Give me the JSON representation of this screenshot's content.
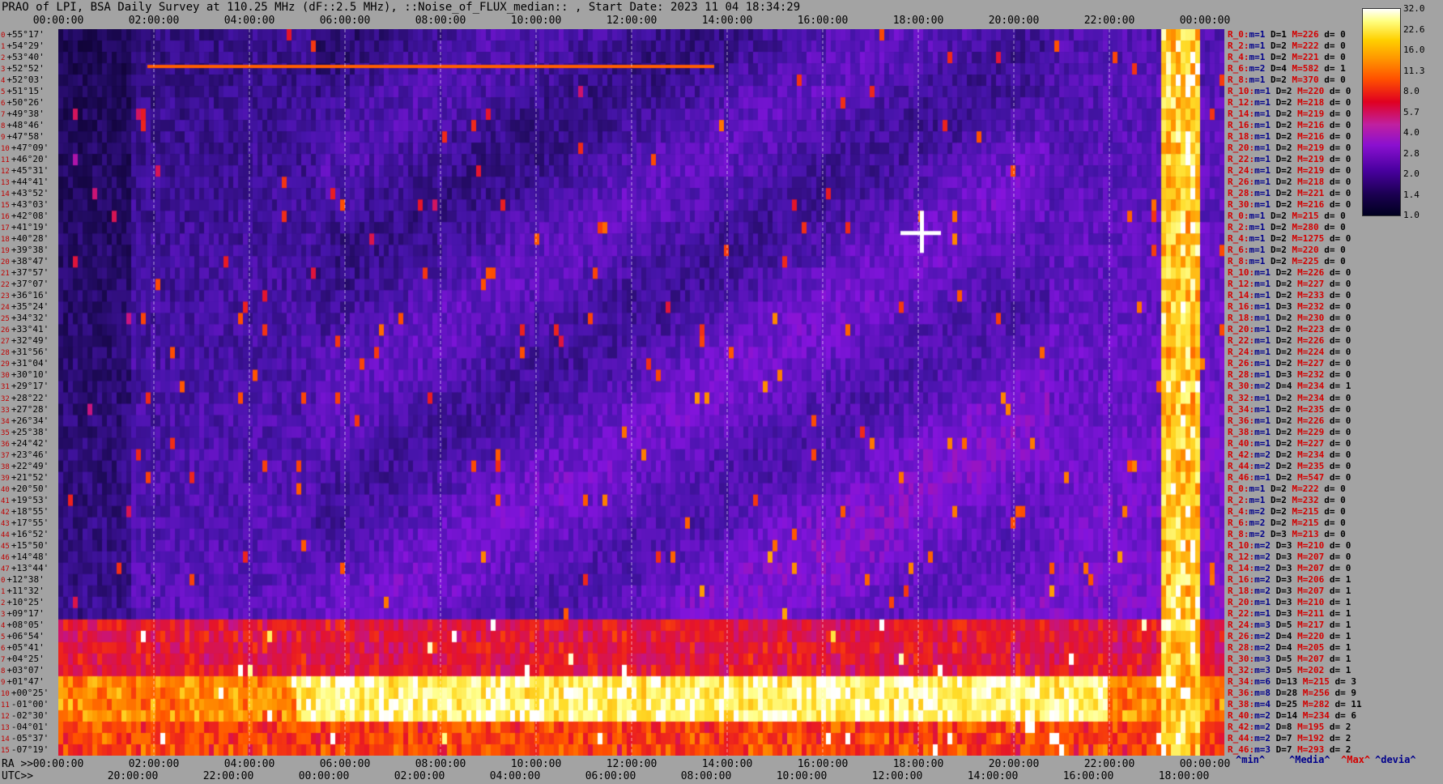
{
  "title": "PRAO of LPI, BSA Daily Survey at 110.25 MHz (dF::2.5 MHz), ::Noise_of_FLUX_median:: , Start Date: 2023 11 04 18:34:29",
  "colors": {
    "background": "#a3a3a3",
    "stat_red": "#d40000",
    "stat_blue": "#00008b"
  },
  "axes": {
    "top_ticks": [
      "00:00:00",
      "02:00:00",
      "04:00:00",
      "06:00:00",
      "08:00:00",
      "10:00:00",
      "12:00:00",
      "14:00:00",
      "16:00:00",
      "18:00:00",
      "20:00:00",
      "22:00:00",
      "00:00:00"
    ],
    "ra_prefix": "RA >>",
    "ra_ticks": [
      "00:00:00",
      "02:00:00",
      "04:00:00",
      "06:00:00",
      "08:00:00",
      "10:00:00",
      "12:00:00",
      "14:00:00",
      "16:00:00",
      "18:00:00",
      "20:00:00",
      "22:00:00",
      "00:00:00"
    ],
    "utc_prefix": "UTC>>",
    "utc_ticks": [
      "20:00:00",
      "22:00:00",
      "00:00:00",
      "02:00:00",
      "04:00:00",
      "06:00:00",
      "08:00:00",
      "10:00:00",
      "12:00:00",
      "14:00:00",
      "16:00:00",
      "18:00:00"
    ]
  },
  "colorbar": {
    "ticks": [
      "32.0",
      "22.6",
      "16.0",
      "11.3",
      "8.0",
      "5.7",
      "4.0",
      "2.8",
      "2.0",
      "1.4",
      "1.0"
    ]
  },
  "legend": [
    "^min^",
    "^Media^",
    "^Max^",
    "^devia^"
  ],
  "dec_labels": [
    "+55°17'",
    "+54°29'",
    "+53°40'",
    "+52°52'",
    "+52°03'",
    "+51°15'",
    "+50°26'",
    "+49°38'",
    "+48°46'",
    "+47°58'",
    "+47°09'",
    "+46°20'",
    "+45°31'",
    "+44°41'",
    "+43°52'",
    "+43°03'",
    "+42°08'",
    "+41°19'",
    "+40°28'",
    "+39°38'",
    "+38°47'",
    "+37°57'",
    "+37°07'",
    "+36°16'",
    "+35°24'",
    "+34°32'",
    "+33°41'",
    "+32°49'",
    "+31°56'",
    "+31°04'",
    "+30°10'",
    "+29°17'",
    "+28°22'",
    "+27°28'",
    "+26°34'",
    "+25°38'",
    "+24°42'",
    "+23°46'",
    "+22°49'",
    "+21°52'",
    "+20°50'",
    "+19°53'",
    "+18°55'",
    "+17°55'",
    "+16°52'",
    "+15°50'",
    "+14°48'",
    "+13°44'",
    "+12°38'",
    "+11°32'",
    "+10°25'",
    "+09°17'",
    "+08°05'",
    "+06°54'",
    "+05°41'",
    "+04°25'",
    "+03°07'",
    "+01°47'",
    "+00°25'",
    "-01°00'",
    "-02°30'",
    "-04°01'",
    "-05°37'",
    "-07°19'"
  ],
  "row_stats": [
    {
      "r": "R_0:",
      "m": "1",
      "D": "1",
      "M": "226",
      "d": "0"
    },
    {
      "r": "R_2:",
      "m": "1",
      "D": "2",
      "M": "222",
      "d": "0"
    },
    {
      "r": "R_4:",
      "m": "1",
      "D": "2",
      "M": "221",
      "d": "0"
    },
    {
      "r": "R_6:",
      "m": "2",
      "D": "4",
      "M": "582",
      "d": "1"
    },
    {
      "r": "R_8:",
      "m": "1",
      "D": "2",
      "M": "370",
      "d": "0"
    },
    {
      "r": "R_10:",
      "m": "1",
      "D": "2",
      "M": "220",
      "d": "0"
    },
    {
      "r": "R_12:",
      "m": "1",
      "D": "2",
      "M": "218",
      "d": "0"
    },
    {
      "r": "R_14:",
      "m": "1",
      "D": "2",
      "M": "219",
      "d": "0"
    },
    {
      "r": "R_16:",
      "m": "1",
      "D": "2",
      "M": "216",
      "d": "0"
    },
    {
      "r": "R_18:",
      "m": "1",
      "D": "2",
      "M": "216",
      "d": "0"
    },
    {
      "r": "R_20:",
      "m": "1",
      "D": "2",
      "M": "219",
      "d": "0"
    },
    {
      "r": "R_22:",
      "m": "1",
      "D": "2",
      "M": "219",
      "d": "0"
    },
    {
      "r": "R_24:",
      "m": "1",
      "D": "2",
      "M": "219",
      "d": "0"
    },
    {
      "r": "R_26:",
      "m": "1",
      "D": "2",
      "M": "218",
      "d": "0"
    },
    {
      "r": "R_28:",
      "m": "1",
      "D": "2",
      "M": "221",
      "d": "0"
    },
    {
      "r": "R_30:",
      "m": "1",
      "D": "2",
      "M": "216",
      "d": "0"
    },
    {
      "r": "R_0:",
      "m": "1",
      "D": "2",
      "M": "215",
      "d": "0"
    },
    {
      "r": "R_2:",
      "m": "1",
      "D": "2",
      "M": "280",
      "d": "0"
    },
    {
      "r": "R_4:",
      "m": "1",
      "D": "2",
      "M": "1275",
      "d": "0"
    },
    {
      "r": "R_6:",
      "m": "1",
      "D": "2",
      "M": "220",
      "d": "0"
    },
    {
      "r": "R_8:",
      "m": "1",
      "D": "2",
      "M": "225",
      "d": "0"
    },
    {
      "r": "R_10:",
      "m": "1",
      "D": "2",
      "M": "226",
      "d": "0"
    },
    {
      "r": "R_12:",
      "m": "1",
      "D": "2",
      "M": "227",
      "d": "0"
    },
    {
      "r": "R_14:",
      "m": "1",
      "D": "2",
      "M": "233",
      "d": "0"
    },
    {
      "r": "R_16:",
      "m": "1",
      "D": "3",
      "M": "232",
      "d": "0"
    },
    {
      "r": "R_18:",
      "m": "1",
      "D": "2",
      "M": "230",
      "d": "0"
    },
    {
      "r": "R_20:",
      "m": "1",
      "D": "2",
      "M": "223",
      "d": "0"
    },
    {
      "r": "R_22:",
      "m": "1",
      "D": "2",
      "M": "226",
      "d": "0"
    },
    {
      "r": "R_24:",
      "m": "1",
      "D": "2",
      "M": "224",
      "d": "0"
    },
    {
      "r": "R_26:",
      "m": "1",
      "D": "2",
      "M": "227",
      "d": "0"
    },
    {
      "r": "R_28:",
      "m": "1",
      "D": "3",
      "M": "232",
      "d": "0"
    },
    {
      "r": "R_30:",
      "m": "2",
      "D": "4",
      "M": "234",
      "d": "1"
    },
    {
      "r": "R_32:",
      "m": "1",
      "D": "2",
      "M": "234",
      "d": "0"
    },
    {
      "r": "R_34:",
      "m": "1",
      "D": "2",
      "M": "235",
      "d": "0"
    },
    {
      "r": "R_36:",
      "m": "1",
      "D": "2",
      "M": "226",
      "d": "0"
    },
    {
      "r": "R_38:",
      "m": "1",
      "D": "2",
      "M": "229",
      "d": "0"
    },
    {
      "r": "R_40:",
      "m": "1",
      "D": "2",
      "M": "227",
      "d": "0"
    },
    {
      "r": "R_42:",
      "m": "2",
      "D": "2",
      "M": "234",
      "d": "0"
    },
    {
      "r": "R_44:",
      "m": "2",
      "D": "2",
      "M": "235",
      "d": "0"
    },
    {
      "r": "R_46:",
      "m": "1",
      "D": "2",
      "M": "547",
      "d": "0"
    },
    {
      "r": "R_0:",
      "m": "1",
      "D": "2",
      "M": "222",
      "d": "0"
    },
    {
      "r": "R_2:",
      "m": "1",
      "D": "2",
      "M": "232",
      "d": "0"
    },
    {
      "r": "R_4:",
      "m": "2",
      "D": "2",
      "M": "215",
      "d": "0"
    },
    {
      "r": "R_6:",
      "m": "2",
      "D": "2",
      "M": "215",
      "d": "0"
    },
    {
      "r": "R_8:",
      "m": "2",
      "D": "3",
      "M": "213",
      "d": "0"
    },
    {
      "r": "R_10:",
      "m": "2",
      "D": "3",
      "M": "210",
      "d": "0"
    },
    {
      "r": "R_12:",
      "m": "2",
      "D": "3",
      "M": "207",
      "d": "0"
    },
    {
      "r": "R_14:",
      "m": "2",
      "D": "3",
      "M": "207",
      "d": "0"
    },
    {
      "r": "R_16:",
      "m": "2",
      "D": "3",
      "M": "206",
      "d": "1"
    },
    {
      "r": "R_18:",
      "m": "2",
      "D": "3",
      "M": "207",
      "d": "1"
    },
    {
      "r": "R_20:",
      "m": "1",
      "D": "3",
      "M": "210",
      "d": "1"
    },
    {
      "r": "R_22:",
      "m": "1",
      "D": "3",
      "M": "211",
      "d": "1"
    },
    {
      "r": "R_24:",
      "m": "3",
      "D": "5",
      "M": "217",
      "d": "1"
    },
    {
      "r": "R_26:",
      "m": "2",
      "D": "4",
      "M": "220",
      "d": "1"
    },
    {
      "r": "R_28:",
      "m": "2",
      "D": "4",
      "M": "205",
      "d": "1"
    },
    {
      "r": "R_30:",
      "m": "3",
      "D": "5",
      "M": "207",
      "d": "1"
    },
    {
      "r": "R_32:",
      "m": "3",
      "D": "5",
      "M": "202",
      "d": "1"
    },
    {
      "r": "R_34:",
      "m": "6",
      "D": "13",
      "M": "215",
      "d": "3"
    },
    {
      "r": "R_36:",
      "m": "8",
      "D": "28",
      "M": "256",
      "d": "9"
    },
    {
      "r": "R_38:",
      "m": "4",
      "D": "25",
      "M": "282",
      "d": "11"
    },
    {
      "r": "R_40:",
      "m": "2",
      "D": "14",
      "M": "234",
      "d": "6"
    },
    {
      "r": "R_42:",
      "m": "2",
      "D": "8",
      "M": "195",
      "d": "2"
    },
    {
      "r": "R_44:",
      "m": "2",
      "D": "7",
      "M": "192",
      "d": "2"
    },
    {
      "r": "R_46:",
      "m": "3",
      "D": "7",
      "M": "293",
      "d": "2"
    }
  ],
  "chart_data": {
    "type": "heatmap",
    "title": "PRAO of LPI, BSA Daily Survey at 110.25 MHz (dF::2.5 MHz), ::Noise_of_FLUX_median:: , Start Date: 2023 11 04 18:34:29",
    "x_axis": "RA 00:00:00 to 24:00:00",
    "y_axis": "Declination +55°17' to -07°19'",
    "colorscale_range": [
      1.0,
      32.0
    ],
    "rows": 64,
    "bright_band_rows": [
      57,
      58,
      59,
      60
    ],
    "bright_column_ra": "~23:10:00",
    "hotspot": {
      "ra": "~20:00:00",
      "dec": "+40°28'"
    }
  }
}
